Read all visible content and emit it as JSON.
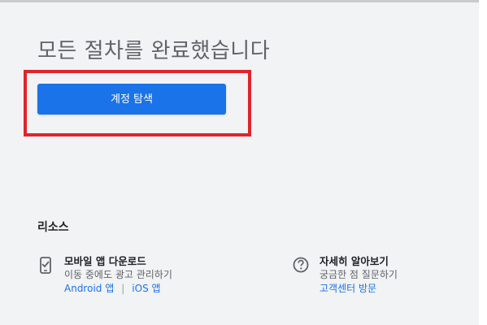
{
  "main": {
    "heading": "모든 절차를 완료했습니다",
    "primary_button_label": "계정 탐색"
  },
  "resources": {
    "section_title": "리소스",
    "mobile": {
      "icon": "mobile-phone-check-icon",
      "title": "모바일 앱 다운로드",
      "description": "이동 중에도 광고 관리하기",
      "links": [
        "Android 앱",
        "iOS 앱"
      ],
      "separator": "|"
    },
    "help": {
      "icon": "help-circle-icon",
      "title": "자세히 알아보기",
      "description": "궁금한 점 질문하기",
      "link": "고객센터 방문"
    }
  },
  "colors": {
    "background": "#f1f3f4",
    "primary": "#1a73e8",
    "highlight_border": "#e0242b",
    "heading_text": "#5f6368"
  }
}
